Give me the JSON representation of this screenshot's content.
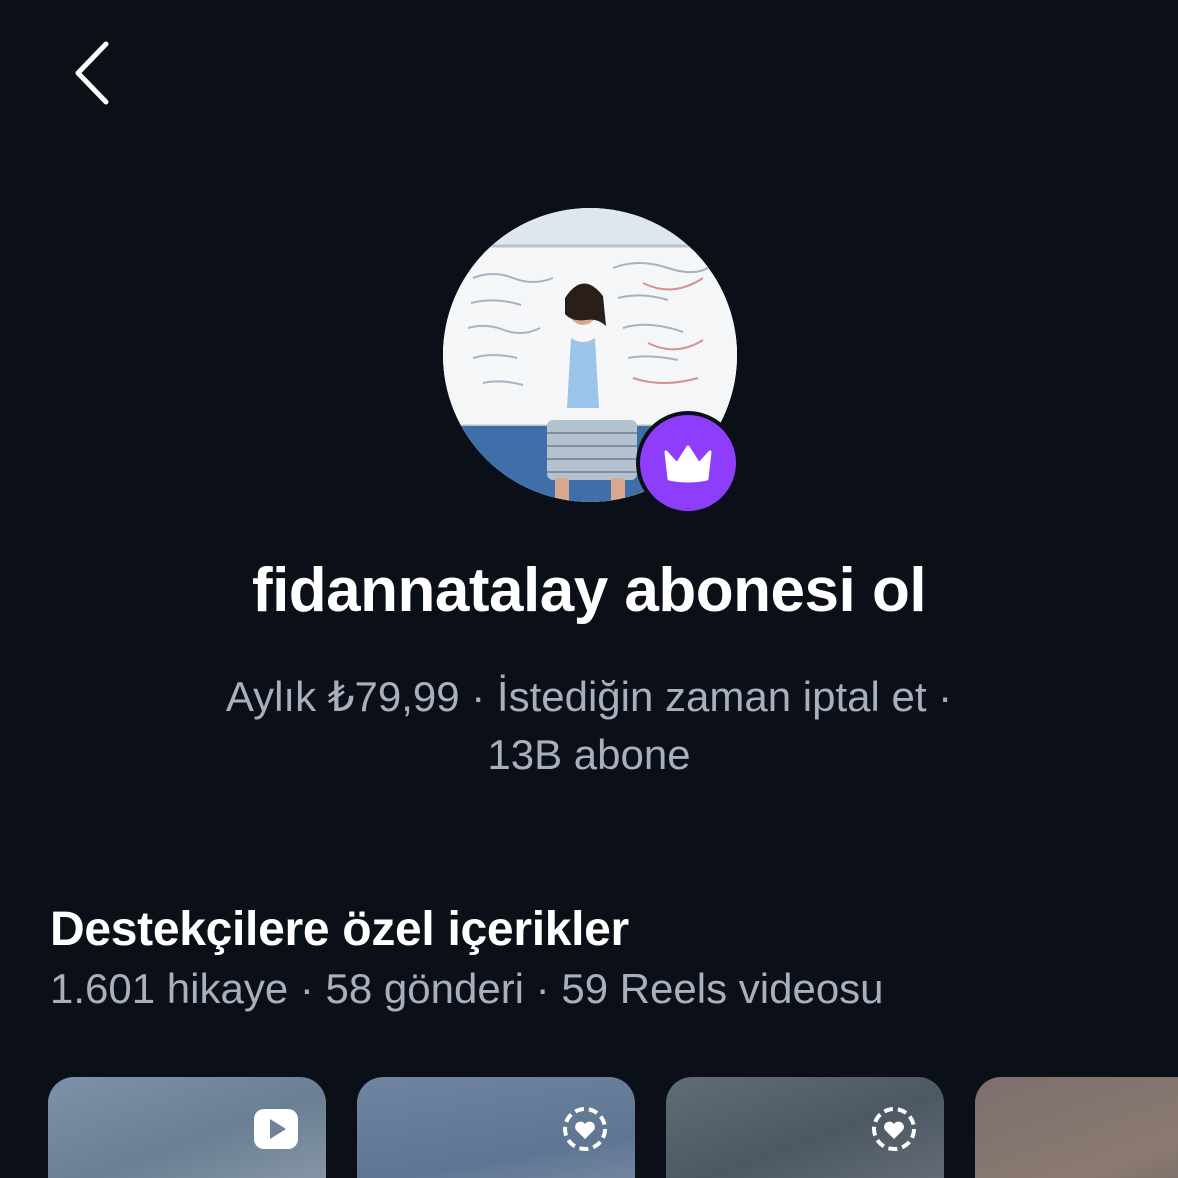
{
  "header": {
    "back_icon": "chevron-left-icon"
  },
  "profile": {
    "badge_icon": "crown-icon",
    "badge_color": "#8e3dfb",
    "title": "fidannatalay abonesi ol",
    "price": "Aylık ₺79,99",
    "cancel_note": "İstediğin zaman iptal et",
    "separator": " · ",
    "subscribers": "13B abone"
  },
  "section": {
    "title": "Destekçilere özel içerikler",
    "stories": "1.601 hikaye",
    "posts": "58 gönderi",
    "reels": "59 Reels videosu",
    "separator": " · "
  },
  "thumbnails": [
    {
      "icon": "play-icon"
    },
    {
      "icon": "heart-ring-icon"
    },
    {
      "icon": "heart-ring-icon"
    },
    {
      "icon": ""
    }
  ]
}
